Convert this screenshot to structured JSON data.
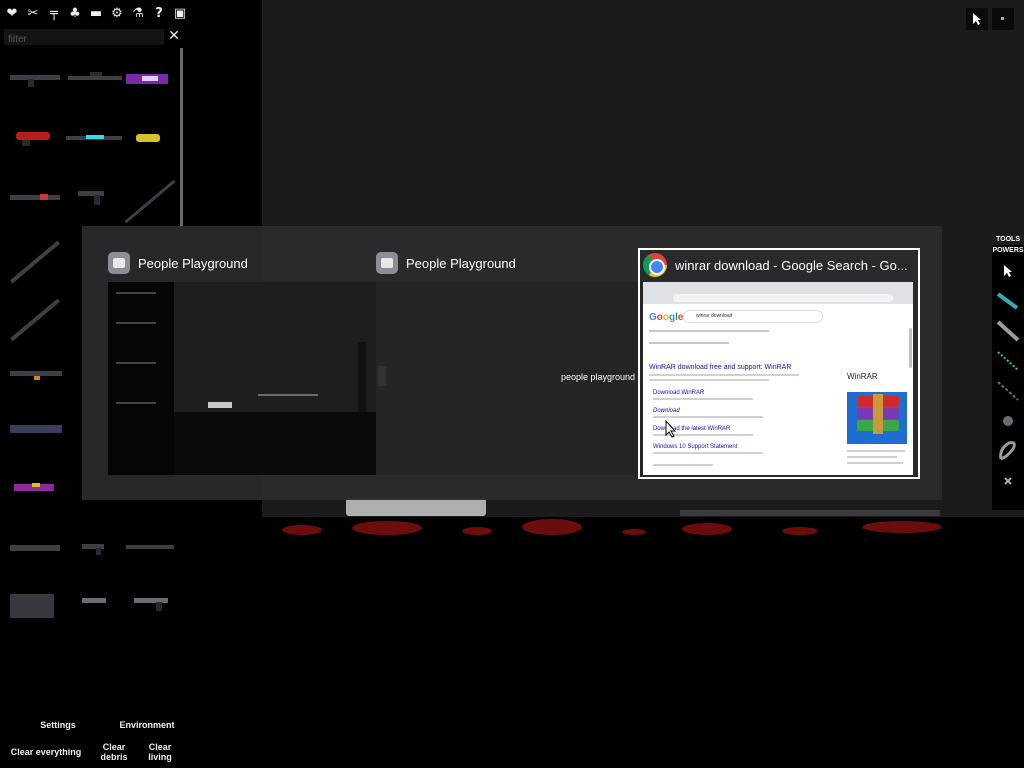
{
  "left_panel": {
    "top_icons": [
      {
        "name": "heart-icon",
        "glyph": "❤"
      },
      {
        "name": "melee-icon",
        "glyph": "✂"
      },
      {
        "name": "firearm-icon",
        "glyph": "╤"
      },
      {
        "name": "plant-icon",
        "glyph": "♣"
      },
      {
        "name": "vehicle-icon",
        "glyph": "▬"
      },
      {
        "name": "gear-icon",
        "glyph": "⚙"
      },
      {
        "name": "flask-icon",
        "glyph": "⚗"
      },
      {
        "name": "help-icon",
        "glyph": "?"
      },
      {
        "name": "save-icon",
        "glyph": "▣"
      }
    ],
    "filter": {
      "placeholder": "filter",
      "value": "",
      "clear_glyph": "✕"
    },
    "bottom_menu": {
      "settings": "Settings",
      "environment": "Environment",
      "clear_everything": "Clear everything",
      "clear_debris": "Clear debris",
      "clear_living": "Clear living"
    }
  },
  "right_toolbar": {
    "tabs": [
      "TOOLS",
      "POWERS"
    ],
    "items": [
      "cursor-tool-icon",
      "drag-tool-icon",
      "knife-tool-icon",
      "laser-tool-icon",
      "chain-tool-icon",
      "explosion-tool-icon",
      "rope-tool-icon",
      "erase-tool-icon"
    ]
  },
  "switcher": {
    "windows": [
      {
        "title": "People Playground",
        "selected": false
      },
      {
        "title": "People Playground",
        "selected": false,
        "thumb_caption": "people playground"
      },
      {
        "title": "winrar download - Google Search - Go...",
        "selected": true
      }
    ],
    "google_thumb": {
      "logo": "Google",
      "query": "winrar download",
      "results": [
        "WinRAR download free and support: WinRAR",
        "Download WinRAR",
        "Download",
        "Download the latest WinRAR",
        "Windows 10 Support Statement"
      ],
      "knowledge_panel_title": "WinRAR"
    }
  },
  "colors": {
    "game_bg": "#1b1b1d",
    "switcher_bg": "#2b2b2d",
    "link": "#1a0dab",
    "accent_blood": "#6b0d0d"
  }
}
